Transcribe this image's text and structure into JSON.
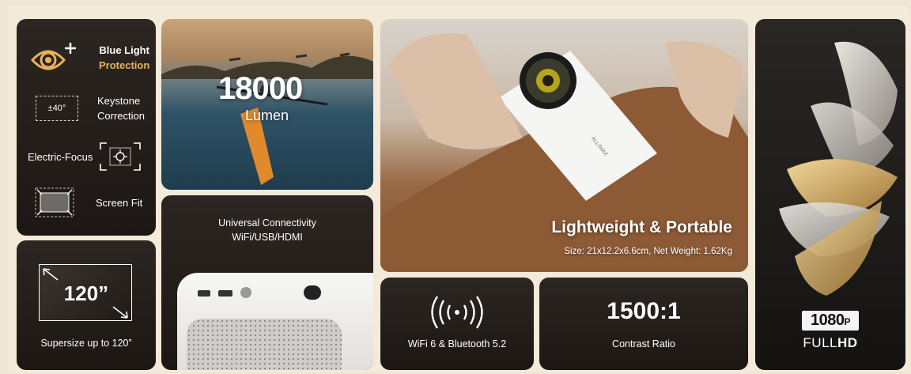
{
  "features": {
    "blue_light_line1": "Blue Light",
    "blue_light_line2": "Protection",
    "keystone_badge": "±40°",
    "keystone_line1": "Keystone",
    "keystone_line2": "Correction",
    "focus_label": "Electric-Focus",
    "screen_fit_label": "Screen Fit"
  },
  "screen_size": {
    "value": "120”",
    "caption": "Supersize up to 120”"
  },
  "brightness": {
    "value": "18000",
    "unit": "Lumen"
  },
  "connectivity": {
    "line1": "Universal Connectivity",
    "line2": "WiFi/USB/HDMI"
  },
  "portable": {
    "title": "Lightweight & Portable",
    "spec": "Size: 21x12.2x6.6cm, Net Weight: 1.62Kg",
    "brand": "ALLIMAX"
  },
  "wireless": {
    "caption": "WiFi 6 & Bluetooth 5.2"
  },
  "contrast": {
    "value": "1500:1",
    "caption": "Contrast Ratio"
  },
  "resolution": {
    "badge_num": "1080",
    "badge_p": "P",
    "full": "FULL",
    "hd": "HD"
  },
  "colors": {
    "accent_gold": "#e9b25a",
    "card_dark": "#231e1a",
    "background": "#f4ead9"
  },
  "icons": [
    "eye-plus-icon",
    "keystone-icon",
    "focus-icon",
    "screen-fit-icon",
    "wifi-signal-icon"
  ]
}
